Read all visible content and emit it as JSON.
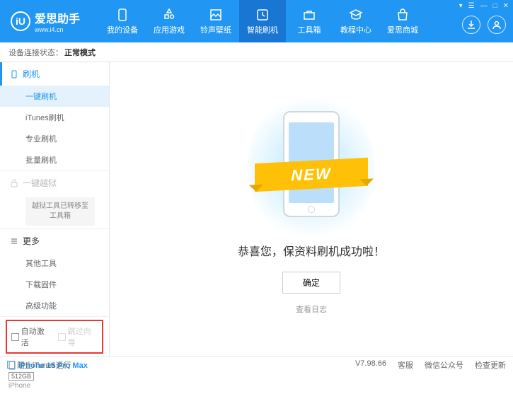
{
  "logo": {
    "title": "爱思助手",
    "url": "www.i4.cn",
    "icon_text": "iU"
  },
  "top_controls": {
    "menu": "▾",
    "list": "☰",
    "min": "—",
    "max": "□",
    "close": "✕"
  },
  "nav": [
    {
      "label": "我的设备",
      "icon": "device"
    },
    {
      "label": "应用游戏",
      "icon": "apps"
    },
    {
      "label": "铃声壁纸",
      "icon": "wallpaper"
    },
    {
      "label": "智能刷机",
      "icon": "flash",
      "active": true
    },
    {
      "label": "工具箱",
      "icon": "toolbox"
    },
    {
      "label": "教程中心",
      "icon": "tutorial"
    },
    {
      "label": "爱思商城",
      "icon": "store"
    }
  ],
  "status": {
    "prefix": "设备连接状态：",
    "value": "正常模式"
  },
  "sidebar": {
    "flash_header": "刷机",
    "flash_items": [
      "一键刷机",
      "iTunes刷机",
      "专业刷机",
      "批量刷机"
    ],
    "jailbreak_header": "一键越狱",
    "jailbreak_note": "越狱工具已转移至\n工具箱",
    "more_header": "更多",
    "more_items": [
      "其他工具",
      "下载固件",
      "高级功能"
    ],
    "checkbox1": "自动激活",
    "checkbox2": "跳过向导",
    "device_name": "iPhone 15 Pro Max",
    "device_storage": "512GB",
    "device_type": "iPhone"
  },
  "main": {
    "ribbon": "NEW",
    "success": "恭喜您，保资料刷机成功啦！",
    "ok": "确定",
    "log": "查看日志"
  },
  "footer": {
    "itunes": "阻止iTunes运行",
    "version": "V7.98.66",
    "links": [
      "客服",
      "微信公众号",
      "检查更新"
    ]
  }
}
